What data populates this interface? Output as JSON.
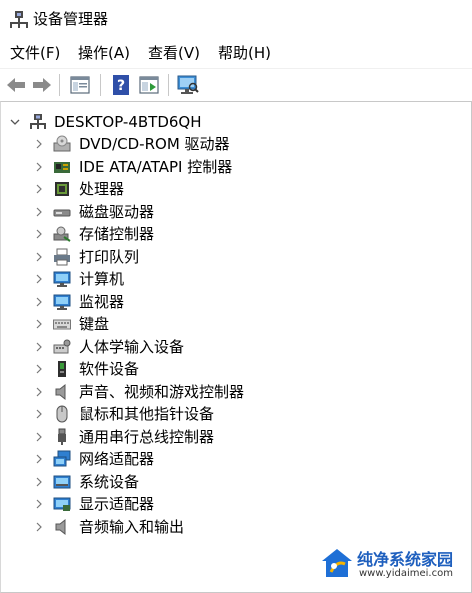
{
  "window": {
    "title": "设备管理器"
  },
  "menu": [
    "文件(F)",
    "操作(A)",
    "查看(V)",
    "帮助(H)"
  ],
  "toolbar": {
    "buttons": [
      "back-arrow-icon",
      "forward-arrow-icon",
      "properties-icon",
      "help-icon",
      "show-hidden-icon",
      "scan-hardware-icon"
    ]
  },
  "tree": {
    "root": "DESKTOP-4BTD6QH",
    "items": [
      {
        "label": "DVD/CD-ROM 驱动器",
        "icon": "dvd-drive-icon"
      },
      {
        "label": "IDE ATA/ATAPI 控制器",
        "icon": "ide-controller-icon"
      },
      {
        "label": "处理器",
        "icon": "processor-icon"
      },
      {
        "label": "磁盘驱动器",
        "icon": "disk-drive-icon"
      },
      {
        "label": "存储控制器",
        "icon": "storage-controller-icon"
      },
      {
        "label": "打印队列",
        "icon": "printer-icon"
      },
      {
        "label": "计算机",
        "icon": "computer-icon"
      },
      {
        "label": "监视器",
        "icon": "monitor-icon"
      },
      {
        "label": "键盘",
        "icon": "keyboard-icon"
      },
      {
        "label": "人体学输入设备",
        "icon": "hid-icon"
      },
      {
        "label": "软件设备",
        "icon": "software-device-icon"
      },
      {
        "label": "声音、视频和游戏控制器",
        "icon": "speaker-icon"
      },
      {
        "label": "鼠标和其他指针设备",
        "icon": "mouse-icon"
      },
      {
        "label": "通用串行总线控制器",
        "icon": "usb-icon"
      },
      {
        "label": "网络适配器",
        "icon": "network-adapter-icon"
      },
      {
        "label": "系统设备",
        "icon": "system-device-icon"
      },
      {
        "label": "显示适配器",
        "icon": "display-adapter-icon"
      },
      {
        "label": "音频输入和输出",
        "icon": "audio-io-icon"
      }
    ]
  },
  "watermark": {
    "text": "纯净系统家园",
    "url": "www.yidaimei.com"
  }
}
